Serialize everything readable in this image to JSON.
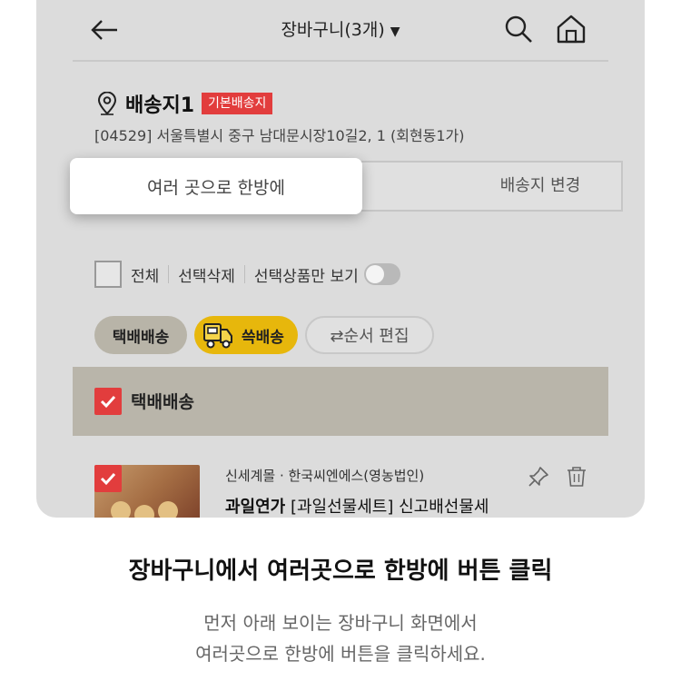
{
  "header": {
    "title": "장바구니(3개)",
    "dropdown_arrow": "▼",
    "icons": [
      "back-arrow-icon",
      "search-icon",
      "home-icon"
    ]
  },
  "address": {
    "name": "배송지1",
    "badge": "기본배송지",
    "full_address": "[04529] 서울특별시 중구 남대문시장10길2, 1 (회현동1가)",
    "multi_delivery_button": "여러 곳으로 한방에",
    "change_button": "배송지 변경"
  },
  "selection": {
    "select_all": "전체",
    "delete_selected": "선택삭제",
    "show_selected_only": "선택상품만 보기",
    "show_selected_only_on": false
  },
  "chips": {
    "parcel": "택배배송",
    "ssg": "쓱배송",
    "edit_order": "⇄순서 편집"
  },
  "section": {
    "title": "택배배송",
    "checked": true
  },
  "product": {
    "seller": "신세계몰 · 한국씨엔에스(영농법인)",
    "name_bold": "과일연가",
    "name_rest": " [과일선물세트] 신고배선물세",
    "checked": true
  },
  "caption": {
    "headline": "장바구니에서 여러곳으로 한방에 버튼 클릭",
    "line1": "먼저 아래 보이는 장바구니 화면에서",
    "line2": "여러곳으로 한방에 버튼을 클릭하세요."
  },
  "colors": {
    "accent_red": "#e23d3d",
    "ssg_yellow": "#e7b70c",
    "section_bg": "#b9b5aa",
    "screen_bg": "#dcdcdc"
  }
}
